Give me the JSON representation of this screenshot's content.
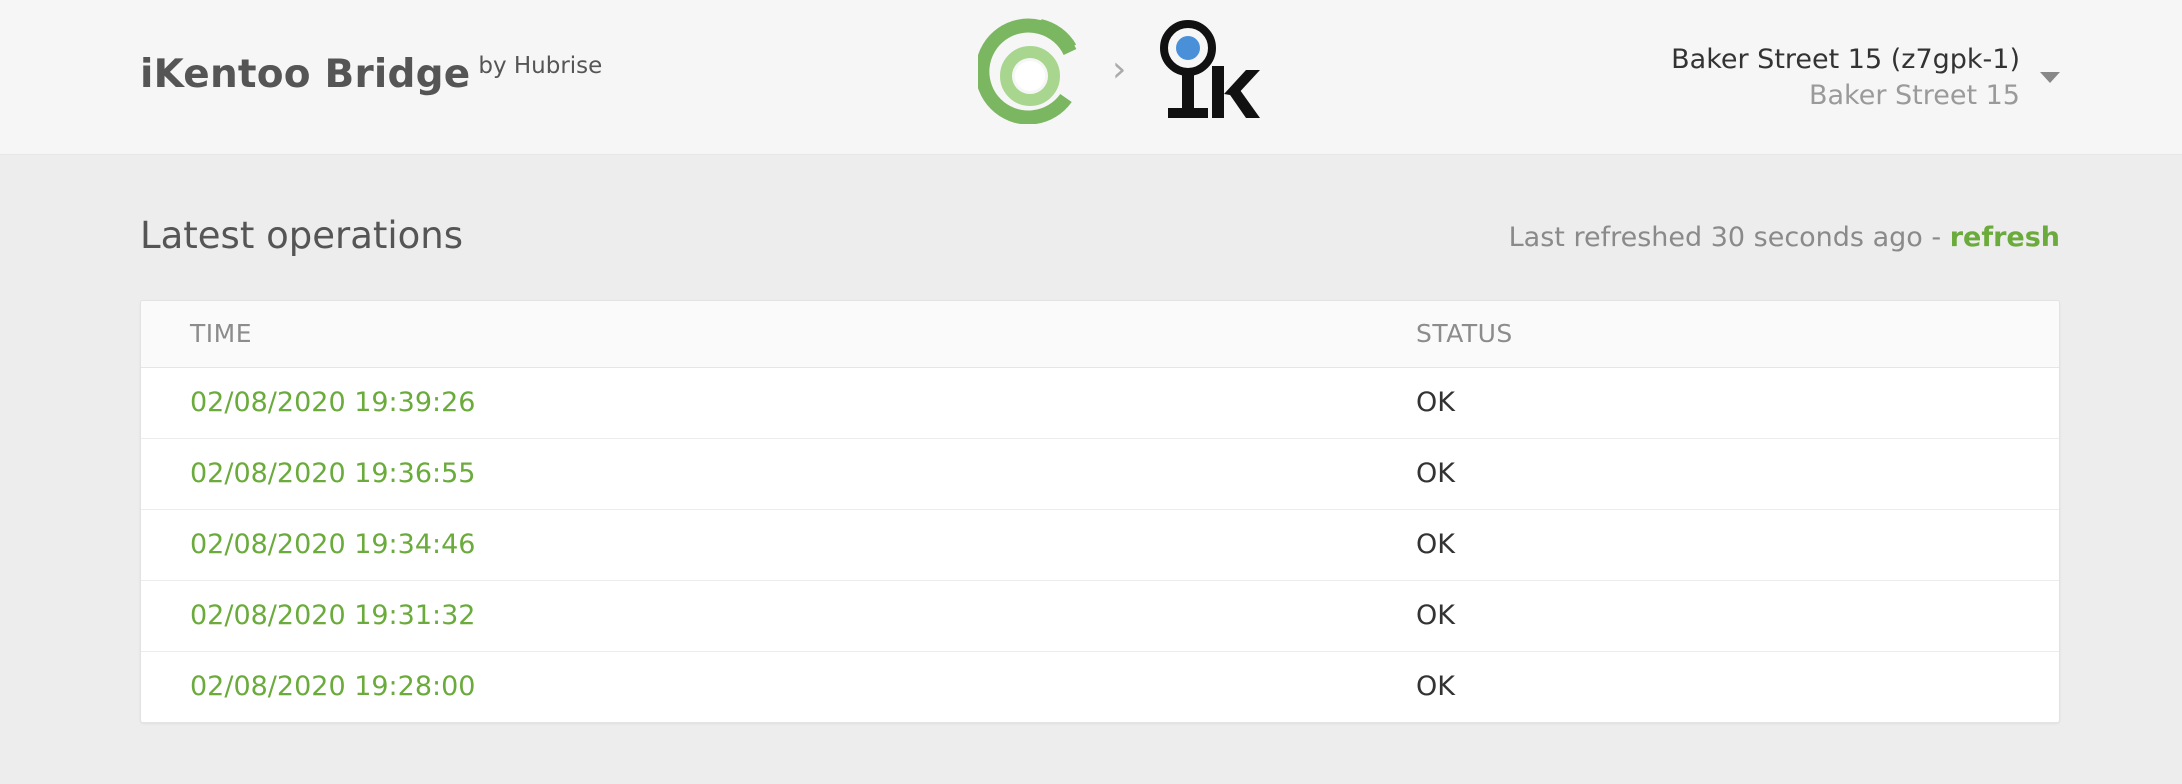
{
  "header": {
    "brand_title": "iKentoo Bridge",
    "brand_by": "by Hubrise",
    "logo_left_icon": "hubrise-logo-icon",
    "separator_icon": "chevron-right-icon",
    "logo_right_icon": "ikentoo-logo-icon",
    "logo_right_text": "k",
    "location": {
      "name": "Baker Street 15 (z7gpk-1)",
      "subtitle": "Baker Street 15",
      "dropdown_icon": "caret-down-icon"
    }
  },
  "main": {
    "title": "Latest operations",
    "refresh_status": "Last refreshed 30 seconds ago - ",
    "refresh_label": "refresh",
    "table": {
      "columns": [
        "TIME",
        "STATUS"
      ],
      "rows": [
        {
          "time": "02/08/2020 19:39:26",
          "status": "OK"
        },
        {
          "time": "02/08/2020 19:36:55",
          "status": "OK"
        },
        {
          "time": "02/08/2020 19:34:46",
          "status": "OK"
        },
        {
          "time": "02/08/2020 19:31:32",
          "status": "OK"
        },
        {
          "time": "02/08/2020 19:28:00",
          "status": "OK"
        }
      ]
    }
  },
  "colors": {
    "accent_green": "#6aab3b",
    "header_bg": "#f6f6f6",
    "page_bg": "#ededed",
    "ikentoo_blue": "#4a90d9"
  }
}
